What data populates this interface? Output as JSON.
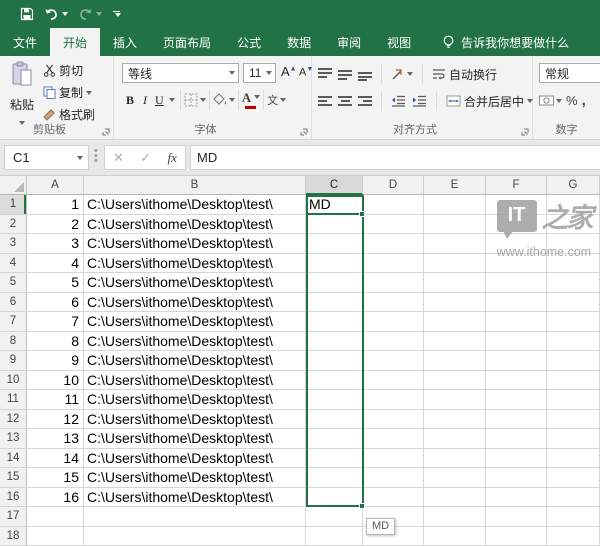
{
  "colors": {
    "excel_green": "#217346",
    "ribbon_bg": "#f3f3f3",
    "font_color_accent": "#c00000",
    "watermark_gray": "#9f9f9f"
  },
  "tabs": [
    {
      "label": "文件",
      "type": "file",
      "active": false
    },
    {
      "label": "开始",
      "type": "normal",
      "active": true
    },
    {
      "label": "插入",
      "type": "normal",
      "active": false
    },
    {
      "label": "页面布局",
      "type": "normal",
      "active": false
    },
    {
      "label": "公式",
      "type": "normal",
      "active": false
    },
    {
      "label": "数据",
      "type": "normal",
      "active": false
    },
    {
      "label": "审阅",
      "type": "normal",
      "active": false
    },
    {
      "label": "视图",
      "type": "normal",
      "active": false
    }
  ],
  "tell_me": "告诉我你想要做什么",
  "ribbon": {
    "clipboard": {
      "group_label": "剪贴板",
      "paste": "粘贴",
      "cut": "剪切",
      "copy": "复制",
      "format_painter": "格式刷"
    },
    "font": {
      "group_label": "字体",
      "font_name": "等线",
      "font_size": "11",
      "bold": "B",
      "italic": "I",
      "underline": "U",
      "font_color": "A",
      "phonetic": "文"
    },
    "alignment": {
      "group_label": "对齐方式",
      "wrap_text": "自动换行",
      "merge_center": "合并后居中"
    },
    "number": {
      "group_label": "数字",
      "format": "常规",
      "percent": "%",
      "comma": ","
    }
  },
  "formula_bar": {
    "name_box": "C1",
    "cancel": "✕",
    "enter": "✓",
    "fx": "fx",
    "value": "MD"
  },
  "grid": {
    "columns": [
      "A",
      "B",
      "C",
      "D",
      "E",
      "F",
      "G"
    ],
    "selected_column": "C",
    "selected_cell": "C1",
    "row_count": 18,
    "a_values": [
      "1",
      "2",
      "3",
      "4",
      "5",
      "6",
      "7",
      "8",
      "9",
      "10",
      "11",
      "12",
      "13",
      "14",
      "15",
      "16"
    ],
    "b_value": "C:\\Users\\ithome\\Desktop\\test\\",
    "c1_value": "MD",
    "fill_tooltip": "MD"
  },
  "watermark": {
    "logo_text": "IT",
    "logo_suffix": "之家",
    "url": "www.ithome.com"
  }
}
